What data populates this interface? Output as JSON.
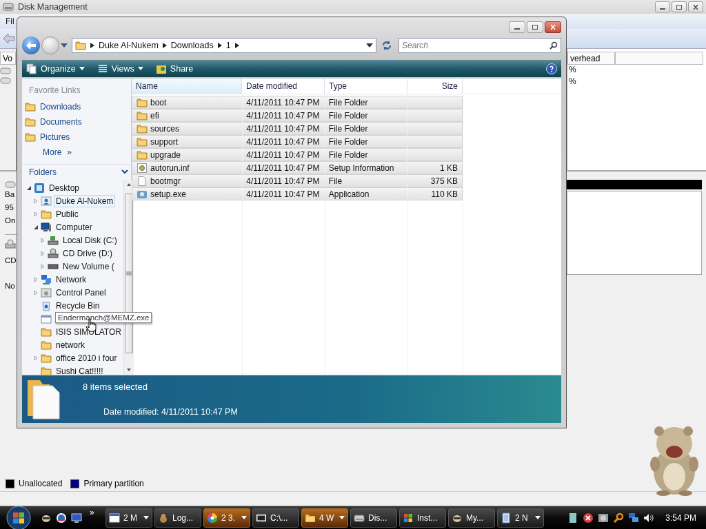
{
  "background_window": {
    "title": "Disk Management",
    "menu": [
      "Fil"
    ],
    "volume_header": "Vo",
    "overhead_header": "verhead",
    "overhead_values": [
      "%",
      "%"
    ],
    "disk_labels": [
      "Ba",
      "95",
      "On"
    ],
    "cd_labels": [
      "CD",
      "No"
    ],
    "legend": [
      {
        "label": "Unallocated",
        "color": "#000000"
      },
      {
        "label": "Primary partition",
        "color": "#000080"
      }
    ]
  },
  "explorer": {
    "breadcrumb": [
      "Duke Al-Nukem",
      "Downloads",
      "1"
    ],
    "search": {
      "placeholder": "Search"
    },
    "toolbar": [
      {
        "label": "Organize",
        "kind": "organize",
        "dropdown": true
      },
      {
        "label": "Views",
        "kind": "views",
        "dropdown": true
      },
      {
        "label": "Share",
        "kind": "share",
        "dropdown": false
      }
    ],
    "favorites": {
      "title": "Favorite Links",
      "items": [
        "Downloads",
        "Documents",
        "Pictures"
      ],
      "more": "More",
      "more_glyph": "»"
    },
    "folders_title": "Folders",
    "tree": [
      {
        "label": "Desktop",
        "kind": "desktop",
        "has_children": true,
        "expanded": true,
        "selected": false,
        "children": [
          {
            "label": "Duke Al-Nukem",
            "kind": "user",
            "has_children": true,
            "expanded": false,
            "selected": true
          },
          {
            "label": "Public",
            "kind": "folder",
            "has_children": true,
            "expanded": false,
            "selected": false
          },
          {
            "label": "Computer",
            "kind": "computer",
            "has_children": true,
            "expanded": true,
            "selected": false,
            "children": [
              {
                "label": "Local Disk (C:)",
                "kind": "drive",
                "has_children": true,
                "expanded": false,
                "selected": false
              },
              {
                "label": "CD Drive (D:)",
                "kind": "cd",
                "has_children": true,
                "expanded": false,
                "selected": false
              },
              {
                "label": "New Volume (",
                "kind": "volume",
                "has_children": true,
                "expanded": false,
                "selected": false
              }
            ]
          },
          {
            "label": "Network",
            "kind": "network",
            "has_children": true,
            "expanded": false,
            "selected": false
          },
          {
            "label": "Control Panel",
            "kind": "control",
            "has_children": true,
            "expanded": false,
            "selected": false
          },
          {
            "label": "Recycle Bin",
            "kind": "recycle",
            "has_children": false,
            "selected": false
          },
          {
            "tooltip": "Endermanch@MEMZ.exe",
            "kind": "program",
            "has_children": false,
            "selected": false
          },
          {
            "label": "ISIS SIMULATOR",
            "kind": "folder",
            "has_children": false,
            "selected": false
          },
          {
            "label": "network",
            "kind": "folder",
            "has_children": false,
            "selected": false
          },
          {
            "label": "office 2010 i four",
            "kind": "folder",
            "has_children": true,
            "expanded": false,
            "selected": false
          },
          {
            "label": "Sushi Cat!!!!!",
            "kind": "folder",
            "has_children": false,
            "selected": false
          }
        ]
      }
    ],
    "columns": [
      "Name",
      "Date modified",
      "Type",
      "Size"
    ],
    "files": [
      {
        "name": "boot",
        "date": "4/11/2011 10:47 PM",
        "type": "File Folder",
        "kind": "folder",
        "selected": true
      },
      {
        "name": "efi",
        "date": "4/11/2011 10:47 PM",
        "type": "File Folder",
        "kind": "folder",
        "selected": true
      },
      {
        "name": "sources",
        "date": "4/11/2011 10:47 PM",
        "type": "File Folder",
        "kind": "folder",
        "selected": true
      },
      {
        "name": "support",
        "date": "4/11/2011 10:47 PM",
        "type": "File Folder",
        "kind": "folder",
        "selected": true
      },
      {
        "name": "upgrade",
        "date": "4/11/2011 10:47 PM",
        "type": "File Folder",
        "kind": "folder",
        "selected": true
      },
      {
        "name": "autorun.inf",
        "date": "4/11/2011 10:47 PM",
        "type": "Setup Information",
        "size": "1 KB",
        "kind": "inf",
        "selected": true
      },
      {
        "name": "bootmgr",
        "date": "4/11/2011 10:47 PM",
        "type": "File",
        "size": "375 KB",
        "kind": "file",
        "selected": true
      },
      {
        "name": "setup.exe",
        "date": "4/11/2011 10:47 PM",
        "type": "Application",
        "size": "110 KB",
        "kind": "exe",
        "selected": true
      }
    ],
    "details": {
      "count": "8 items selected",
      "date_label": "Date modified:",
      "date": "4/11/2011 10:47 PM"
    }
  },
  "taskbar": {
    "overflow": "»",
    "buttons": [
      {
        "label": "2 M",
        "kind": "window",
        "dropdown": true,
        "highlighted": false
      },
      {
        "label": "Log...",
        "kind": "hamster",
        "dropdown": false,
        "highlighted": false
      },
      {
        "label": "2 3.",
        "kind": "wheel",
        "dropdown": true,
        "highlighted": true
      },
      {
        "label": "C:\\...",
        "kind": "zip",
        "dropdown": false,
        "highlighted": false
      },
      {
        "label": "4 W",
        "kind": "folder",
        "dropdown": true,
        "highlighted": true
      },
      {
        "label": "Dis...",
        "kind": "disk",
        "dropdown": false,
        "highlighted": false
      },
      {
        "label": "Inst...",
        "kind": "flag",
        "dropdown": false,
        "highlighted": false
      },
      {
        "label": "My...",
        "kind": "raccoon",
        "dropdown": false,
        "highlighted": false
      },
      {
        "label": "2 N",
        "kind": "notepad",
        "dropdown": true,
        "highlighted": false
      }
    ],
    "clock": "3:54 PM"
  }
}
